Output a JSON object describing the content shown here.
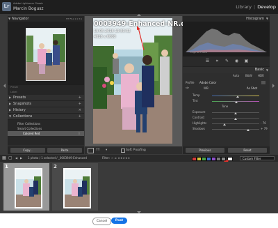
{
  "app": {
    "logo": "Lr",
    "name": "Adobe Lightroom Classic",
    "user": "Marcin Bogusz",
    "modules": [
      "Library",
      "Develop"
    ],
    "active_module": "Develop"
  },
  "left_panel": {
    "navigator_label": "Navigator",
    "navigator_options": "FIT  FILL  1:1  3:1",
    "history_preview": [
      "Preset",
      "Label"
    ],
    "sections": [
      "Presets",
      "Snapshots",
      "History",
      "Collections"
    ],
    "collections_filter": "Filter Collections",
    "collection_rows": [
      {
        "label": "Smart Collections",
        "count": ""
      },
      {
        "label": "Colored Red",
        "count": "0"
      }
    ],
    "copy_label": "Copy...",
    "paste_label": "Paste"
  },
  "photo_overlay": {
    "filename": "0003949-Enhanced-NR.dng",
    "line2": "19.05.2018 19:50:02",
    "line3": "4016 x 6000"
  },
  "center_toolbar": {
    "soft_proofing": "Soft Proofing"
  },
  "right_panel": {
    "histogram_label": "Histogram",
    "original_photo": "Original Photo",
    "basic_label": "Basic",
    "profile_buttons": [
      "Auto",
      "B&W",
      "HDR"
    ],
    "profile_label": "Profile",
    "profile_value": "Adobe Color",
    "wb_label": "WB",
    "wb_value": "As Shot",
    "rows": [
      {
        "label": "Temp",
        "value": ""
      },
      {
        "label": "Tint",
        "value": ""
      },
      {
        "label": "Tone",
        "value": ""
      },
      {
        "label": "Exposure",
        "value": ""
      },
      {
        "label": "Contrast",
        "value": ""
      },
      {
        "label": "Highlights",
        "value": "- 76"
      },
      {
        "label": "Shadows",
        "value": "+ 79"
      }
    ],
    "previous_label": "Previous",
    "reset_label": "Reset"
  },
  "filter_bar": {
    "photo_info": "1 photo / 1 selected / _0003949-Enhanced",
    "filter_label": "Filter:",
    "custom_filter": "Custom Filter",
    "label_colors": [
      "#d23b3b",
      "#d6c43a",
      "#47a34a",
      "#3f6fd1",
      "#8e4fc9",
      "#777777",
      "#ffffff",
      "#888888"
    ]
  },
  "filmstrip": {
    "cells": [
      {
        "number": "1",
        "selected": true
      },
      {
        "number": "2",
        "selected": false
      }
    ]
  },
  "dialog": {
    "cancel_label": "Cancel",
    "post_label": "Post",
    "post_color": "#1473e6"
  },
  "annotation_color": "#e0302a"
}
